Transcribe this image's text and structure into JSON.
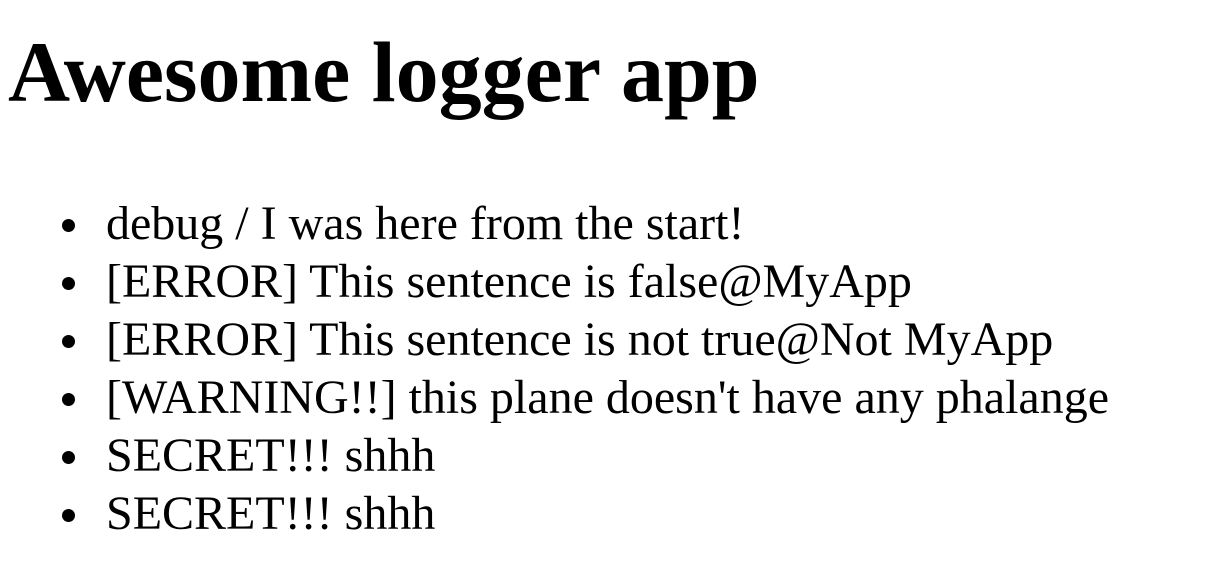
{
  "page": {
    "title": "Awesome logger app"
  },
  "log_entries": [
    {
      "text": "debug / I was here from the start!"
    },
    {
      "text": "[ERROR] This sentence is false@MyApp"
    },
    {
      "text": "[ERROR] This sentence is not true@Not MyApp"
    },
    {
      "text": "[WARNING!!] this plane doesn't have any phalange"
    },
    {
      "text": "SECRET!!! shhh"
    },
    {
      "text": "SECRET!!! shhh"
    }
  ]
}
